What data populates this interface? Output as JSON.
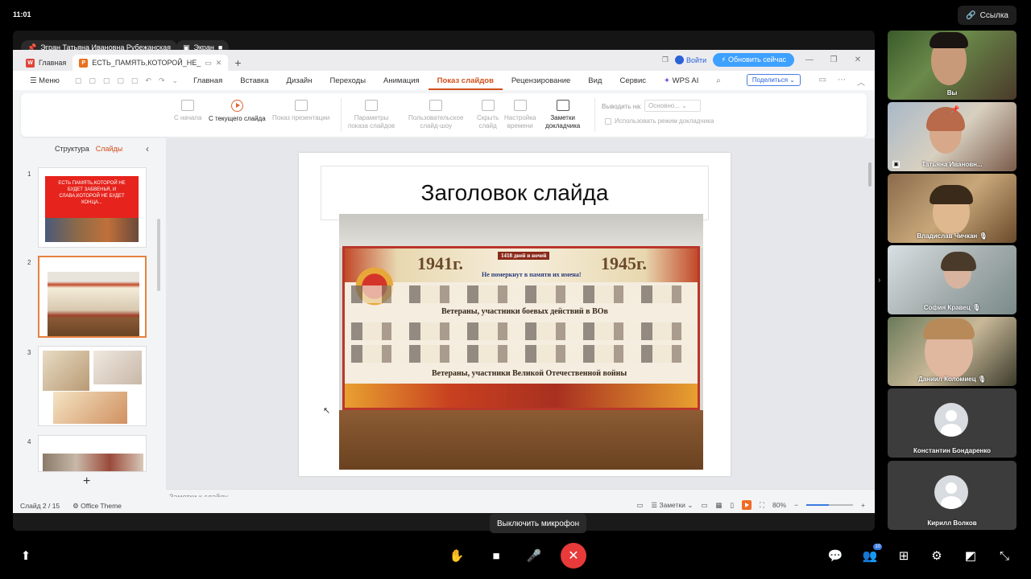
{
  "system": {
    "time": "11:01",
    "link_button": "Ссылка"
  },
  "screen_share": {
    "presenter": "Эгран Татьяна Ивановна Рубежанская",
    "screen_label": "Экран"
  },
  "wps": {
    "tabs": [
      {
        "label": "Главная"
      },
      {
        "label": "ЕСТЬ_ПАМЯТЬ,КОТОРОЙ_НЕ_"
      }
    ],
    "login": "Войти",
    "update_button": "Обновить сейчас",
    "menu_label": "Меню",
    "menu_items": [
      "Главная",
      "Вставка",
      "Дизайн",
      "Переходы",
      "Анимация",
      "Показ слайдов",
      "Рецензирование",
      "Вид",
      "Сервис",
      "WPS AI"
    ],
    "active_menu": "Показ слайдов",
    "share_button": "Поделиться",
    "ribbon": {
      "from_start": "С начала",
      "from_current": "С текущего слайда",
      "show_presentation": "Показ презентации",
      "params_1": "Параметры",
      "params_2": "показа слайдов",
      "custom_1": "Пользовательское",
      "custom_2": "слайд-шоу",
      "hide_1": "Скрыть",
      "hide_2": "слайд",
      "timing_1": "Настройка",
      "timing_2": "времени",
      "notes_1": "Заметки",
      "notes_2": "докладчика",
      "output_label": "Выводить на:",
      "output_value": "Основно...",
      "presenter_mode": "Использовать режим докладчика"
    },
    "side_tabs": {
      "structure": "Структура",
      "slides": "Слайды"
    },
    "slide_numbers": [
      "1",
      "2",
      "3",
      "4"
    ],
    "thumb1_text": "ЕСТЬ ПАМЯТЬ,КОТОРОЙ НЕ БУДЕТ ЗАБВЕНЬЯ, И СЛАВА,КОТОРОЙ НЕ БУДЕТ КОНЦА...",
    "slide_title": "Заголовок слайда",
    "photo": {
      "year_left": "1941г.",
      "year_right": "1945г.",
      "days": "1418 дней и ночей",
      "line1": "Не померкнут в памяти их имена!",
      "line2": "Ветераны, участники боевых действий в ВОв",
      "line3": "Ветераны, участники Великой Отечественной войны"
    },
    "notes_placeholder": "Заметки к слайду",
    "status": {
      "slide_counter": "Слайд 2 / 15",
      "theme": "Office Theme",
      "notes_toggle": "Заметки",
      "zoom": "80%"
    }
  },
  "participants": [
    {
      "name": "Вы"
    },
    {
      "name": "Татьяна Ивановн..."
    },
    {
      "name": "Владислав Чичкан"
    },
    {
      "name": "София Кравец"
    },
    {
      "name": "Даниил Коломиец"
    },
    {
      "name": "Константин Бондаренко"
    },
    {
      "name": "Кирилл Волков"
    }
  ],
  "controls": {
    "tooltip": "Выключить микрофон",
    "participants_badge": "10"
  },
  "colors": {
    "accent": "#d2501c",
    "hangup": "#e83a3a",
    "update": "#3ea0ff"
  }
}
